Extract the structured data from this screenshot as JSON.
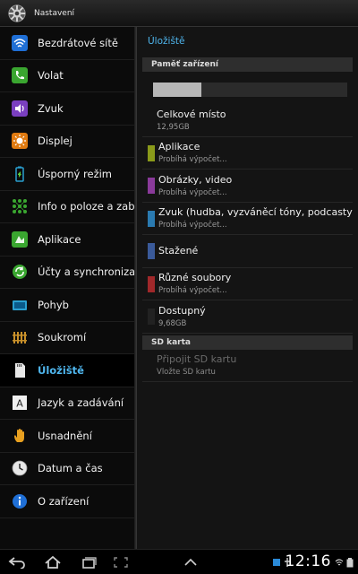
{
  "window": {
    "title": "Nastavení",
    "app_icon": "gear-icon"
  },
  "sidebar": {
    "active_index": 10,
    "items": [
      {
        "label": "Bezdrátové sítě",
        "icon": "wifi-icon",
        "color": "#1f6fd6"
      },
      {
        "label": "Volat",
        "icon": "phone-icon",
        "color": "#3aa630"
      },
      {
        "label": "Zvuk",
        "icon": "speaker-icon",
        "color": "#7a3fc0"
      },
      {
        "label": "Displej",
        "icon": "display-icon",
        "color": "#e07a10"
      },
      {
        "label": "Úsporný režim",
        "icon": "battery-icon",
        "color": "#2a9fd0"
      },
      {
        "label": "Info o poloze a zab",
        "icon": "location-grid-icon",
        "color": "#3aa630"
      },
      {
        "label": "Aplikace",
        "icon": "apps-icon",
        "color": "#3aa630"
      },
      {
        "label": "Účty a synchroniza",
        "icon": "sync-icon",
        "color": "#3aa630"
      },
      {
        "label": "Pohyb",
        "icon": "motion-icon",
        "color": "#2a9fd0"
      },
      {
        "label": "Soukromí",
        "icon": "privacy-icon",
        "color": "#c8902a"
      },
      {
        "label": "Úložiště",
        "icon": "sd-card-icon",
        "color": "#ffffff"
      },
      {
        "label": "Jazyk a zadávání",
        "icon": "keyboard-icon",
        "color": "#ffffff"
      },
      {
        "label": "Usnadnění",
        "icon": "hand-icon",
        "color": "#e8a020"
      },
      {
        "label": "Datum a čas",
        "icon": "clock-icon",
        "color": "#ffffff"
      },
      {
        "label": "O zařízení",
        "icon": "info-icon",
        "color": "#1f6fd6"
      }
    ]
  },
  "main": {
    "title": "Úložiště",
    "device_section": {
      "header": "Paměť zařízení",
      "usage_fraction": 0.25,
      "total": {
        "label": "Celkové místo",
        "value": "12,95GB"
      },
      "categories": [
        {
          "label": "Aplikace",
          "status": "Probíhá výpočet...",
          "color": "#8a9a1a"
        },
        {
          "label": "Obrázky, video",
          "status": "Probíhá výpočet...",
          "color": "#8a3a9a"
        },
        {
          "label": "Zvuk (hudba, vyzváněcí tóny, podcasty",
          "status": "Probíhá výpočet...",
          "color": "#2a7ab0"
        },
        {
          "label": "Stažené",
          "status": "",
          "color": "#3a5a9a"
        },
        {
          "label": "Různé soubory",
          "status": "Probíhá výpočet...",
          "color": "#a0282a"
        },
        {
          "label": "Dostupný",
          "status": "9,68GB",
          "color": "#222222"
        }
      ]
    },
    "sd_section": {
      "header": "SD karta",
      "mount": {
        "label": "Připojit SD kartu",
        "hint": "Vložte SD kartu"
      }
    }
  },
  "statusbar": {
    "clock": "12:16",
    "nav_icons": [
      "back-icon",
      "home-icon",
      "recent-apps-icon",
      "screenshot-icon",
      "up-arrow-icon"
    ]
  }
}
